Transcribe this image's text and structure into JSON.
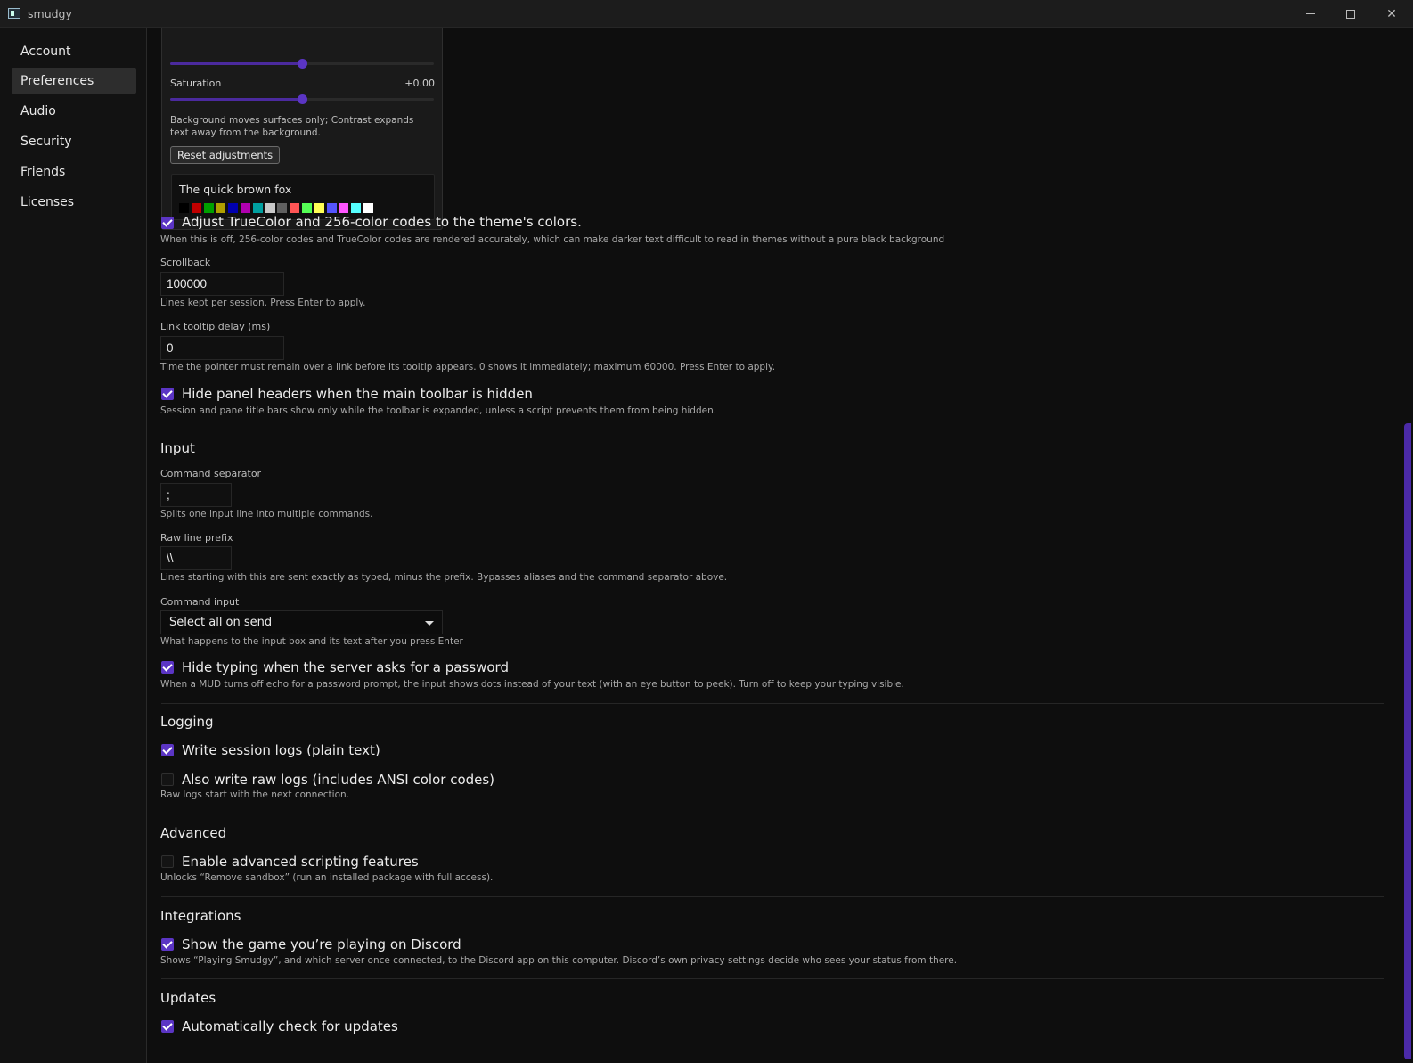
{
  "window": {
    "title": "smudgy",
    "minimize_glyph": "",
    "close_glyph": "✕"
  },
  "sidebar": {
    "items": [
      {
        "label": "Account"
      },
      {
        "label": "Preferences",
        "active": true
      },
      {
        "label": "Audio"
      },
      {
        "label": "Security"
      },
      {
        "label": "Friends"
      },
      {
        "label": "Licenses"
      }
    ]
  },
  "appearance_panel": {
    "background_slider": {
      "value_fraction": 0.5
    },
    "saturation_label": "Saturation",
    "saturation_value": "+0.00",
    "saturation_slider": {
      "value_fraction": 0.5
    },
    "note": "Background moves surfaces only; Contrast expands text away from the background.",
    "reset_label": "Reset adjustments",
    "preview_text": "The quick brown fox",
    "palette": [
      "#000000",
      "#c00000",
      "#00a000",
      "#b0a000",
      "#0000b0",
      "#b000b0",
      "#00a0a0",
      "#c8c8c8",
      "#606060",
      "#ff5555",
      "#55ff55",
      "#ffff55",
      "#5555ff",
      "#ff55ff",
      "#55ffff",
      "#ffffff"
    ]
  },
  "display": {
    "truecolor_checkbox": {
      "label": "Adjust TrueColor and 256-color codes to the theme's colors.",
      "checked": true
    },
    "truecolor_hint": "When this is off, 256-color codes and TrueColor codes are rendered accurately, which can make darker text difficult to read in themes without a pure black background",
    "scrollback_label": "Scrollback",
    "scrollback_value": "100000",
    "scrollback_hint": "Lines kept per session. Press Enter to apply.",
    "tooltip_delay_label": "Link tooltip delay (ms)",
    "tooltip_delay_value": "0",
    "tooltip_delay_hint": "Time the pointer must remain over a link before its tooltip appears. 0 shows it immediately; maximum 60000. Press Enter to apply.",
    "hide_headers_checkbox": {
      "label": "Hide panel headers when the main toolbar is hidden",
      "checked": true
    },
    "hide_headers_hint": "Session and pane title bars show only while the toolbar is expanded, unless a script prevents them from being hidden."
  },
  "input_section": {
    "title": "Input",
    "separator_label": "Command separator",
    "separator_value": ";",
    "separator_hint": "Splits one input line into multiple commands.",
    "raw_prefix_label": "Raw line prefix",
    "raw_prefix_value": "\\\\",
    "raw_prefix_hint": "Lines starting with this are sent exactly as typed, minus the prefix. Bypasses aliases and the command separator above.",
    "command_input_label": "Command input",
    "command_input_value": "Select all on send",
    "command_input_hint": "What happens to the input box and its text after you press Enter",
    "hide_password_checkbox": {
      "label": "Hide typing when the server asks for a password",
      "checked": true
    },
    "hide_password_hint": "When a MUD turns off echo for a password prompt, the input shows dots instead of your text (with an eye button to peek). Turn off to keep your typing visible."
  },
  "logging_section": {
    "title": "Logging",
    "session_logs_checkbox": {
      "label": "Write session logs (plain text)",
      "checked": true
    },
    "raw_logs_checkbox": {
      "label": "Also write raw logs (includes ANSI color codes)",
      "checked": false
    },
    "raw_logs_hint": "Raw logs start with the next connection."
  },
  "advanced_section": {
    "title": "Advanced",
    "scripting_checkbox": {
      "label": "Enable advanced scripting features",
      "checked": false
    },
    "scripting_hint": "Unlocks “Remove sandbox” (run an installed package with full access)."
  },
  "integrations_section": {
    "title": "Integrations",
    "discord_checkbox": {
      "label": "Show the game you’re playing on Discord",
      "checked": true
    },
    "discord_hint": "Shows “Playing Smudgy”, and which server once connected, to the Discord app on this computer. Discord’s own privacy settings decide who sees your status from there."
  },
  "updates_section": {
    "title": "Updates",
    "auto_update_checkbox": {
      "label": "Automatically check for updates",
      "checked": true
    }
  },
  "colors": {
    "accent": "#5b35c4",
    "scrollbar_thumb": "#4b2aa8"
  }
}
